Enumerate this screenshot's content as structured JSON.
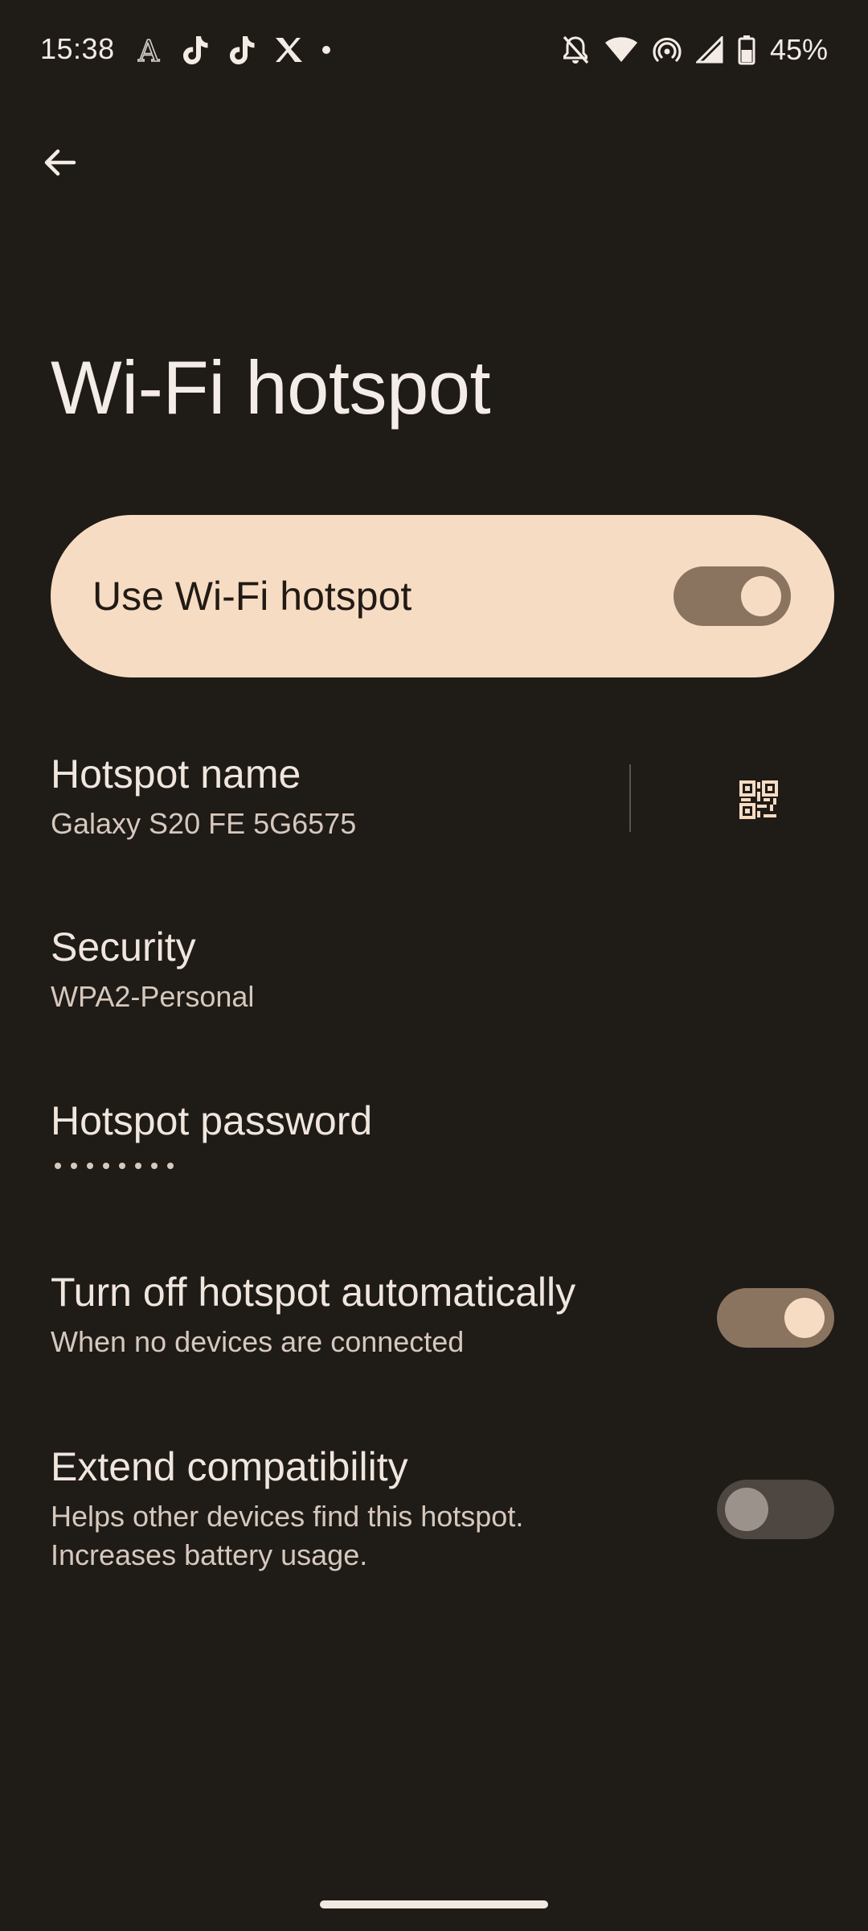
{
  "status_bar": {
    "time": "15:38",
    "battery_text": "45%",
    "notification_icons": [
      "font-app-icon",
      "tiktok-icon",
      "tiktok-icon",
      "x-app-icon",
      "more-dot-icon"
    ],
    "system_icons": [
      "notifications-off-icon",
      "wifi-icon",
      "hotspot-icon",
      "cellular-signal-icon",
      "battery-icon"
    ]
  },
  "app_bar": {
    "back_icon": "arrow-back-icon"
  },
  "page": {
    "title": "Wi-Fi hotspot"
  },
  "main_toggle": {
    "label": "Use Wi-Fi hotspot",
    "checked": true
  },
  "settings": {
    "hotspot_name": {
      "title": "Hotspot name",
      "summary": "Galaxy S20 FE 5G6575",
      "action_icon": "qr-code-icon"
    },
    "security": {
      "title": "Security",
      "summary": "WPA2-Personal"
    },
    "password": {
      "title": "Hotspot password",
      "masked_length": 8
    },
    "auto_off": {
      "title": "Turn off hotspot automatically",
      "summary": "When no devices are connected",
      "checked": true
    },
    "extend_compat": {
      "title": "Extend compatibility",
      "summary_line1": "Helps other devices find this hotspot.",
      "summary_line2": "Increases battery usage.",
      "checked": false
    }
  },
  "colors": {
    "background": "#1f1b17",
    "card": "#f7dcc4",
    "switch_on_track": "#8a7460",
    "switch_off_track": "#4e4640"
  }
}
